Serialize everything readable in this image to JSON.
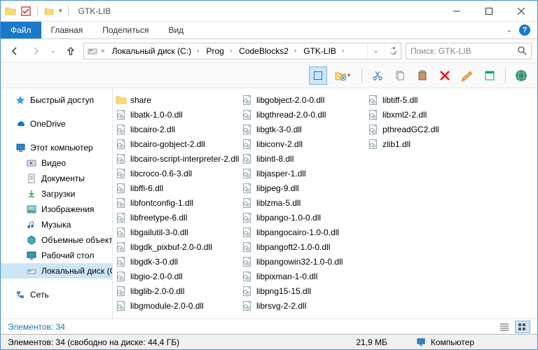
{
  "window": {
    "title": "GTK-LIB"
  },
  "ribbon": {
    "tabs": {
      "file": "Файл",
      "home": "Главная",
      "share": "Поделиться",
      "view": "Вид"
    }
  },
  "breadcrumbs": {
    "disk": "Локальный диск (C:)",
    "p1": "Prog",
    "p2": "CodeBlocks2",
    "p3": "GTK-LIB"
  },
  "search": {
    "placeholder": "Поиск: GTK-LIB"
  },
  "sidebar": {
    "quick": "Быстрый доступ",
    "onedrive": "OneDrive",
    "pc": "Этот компьютер",
    "videos": "Видео",
    "documents": "Документы",
    "downloads": "Загрузки",
    "pictures": "Изображения",
    "music": "Музыка",
    "volumes": "Объемные объекты",
    "desktop": "Рабочий стол",
    "disk_c": "Локальный диск (C:)",
    "network": "Сеть"
  },
  "files": {
    "col1": [
      {
        "n": "share",
        "t": "folder"
      },
      {
        "n": "libatk-1.0-0.dll",
        "t": "dll"
      },
      {
        "n": "libcairo-2.dll",
        "t": "dll"
      },
      {
        "n": "libcairo-gobject-2.dll",
        "t": "dll"
      },
      {
        "n": "libcairo-script-interpreter-2.dll",
        "t": "dll"
      },
      {
        "n": "libcroco-0.6-3.dll",
        "t": "dll"
      },
      {
        "n": "libffi-6.dll",
        "t": "dll"
      },
      {
        "n": "libfontconfig-1.dll",
        "t": "dll"
      },
      {
        "n": "libfreetype-6.dll",
        "t": "dll"
      },
      {
        "n": "libgailutil-3-0.dll",
        "t": "dll"
      },
      {
        "n": "libgdk_pixbuf-2.0-0.dll",
        "t": "dll"
      },
      {
        "n": "libgdk-3-0.dll",
        "t": "dll"
      },
      {
        "n": "libgio-2.0-0.dll",
        "t": "dll"
      },
      {
        "n": "libglib-2.0-0.dll",
        "t": "dll"
      },
      {
        "n": "libgmodule-2.0-0.dll",
        "t": "dll"
      },
      {
        "n": "libgobject-2.0-0.dll",
        "t": "dll"
      }
    ],
    "col2": [
      {
        "n": "libgthread-2.0-0.dll",
        "t": "dll"
      },
      {
        "n": "libgtk-3-0.dll",
        "t": "dll"
      },
      {
        "n": "libiconv-2.dll",
        "t": "dll"
      },
      {
        "n": "libintl-8.dll",
        "t": "dll"
      },
      {
        "n": "libjasper-1.dll",
        "t": "dll"
      },
      {
        "n": "libjpeg-9.dll",
        "t": "dll"
      },
      {
        "n": "liblzma-5.dll",
        "t": "dll"
      },
      {
        "n": "libpango-1.0-0.dll",
        "t": "dll"
      },
      {
        "n": "libpangocairo-1.0-0.dll",
        "t": "dll"
      },
      {
        "n": "libpangoft2-1.0-0.dll",
        "t": "dll"
      },
      {
        "n": "libpangowin32-1.0-0.dll",
        "t": "dll"
      },
      {
        "n": "libpixman-1-0.dll",
        "t": "dll"
      },
      {
        "n": "libpng15-15.dll",
        "t": "dll"
      },
      {
        "n": "librsvg-2-2.dll",
        "t": "dll"
      },
      {
        "n": "libtiff-5.dll",
        "t": "dll"
      },
      {
        "n": "libxml2-2.dll",
        "t": "dll"
      }
    ],
    "col3": [
      {
        "n": "pthreadGC2.dll",
        "t": "dll"
      },
      {
        "n": "zlib1.dll",
        "t": "dll"
      }
    ]
  },
  "status": {
    "items": "Элементов: 34",
    "detail": "Элементов: 34 (свободно на диске: 44,4 ГБ)",
    "size": "21,9 МБ",
    "computer": "Компьютер"
  }
}
